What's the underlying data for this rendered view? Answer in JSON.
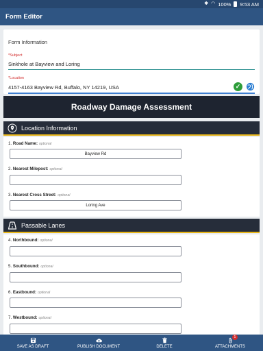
{
  "status_bar": {
    "battery": "100%",
    "time": "9:53 AM"
  },
  "app_bar": {
    "title": "Form Editor"
  },
  "form_information": {
    "title": "Form Information",
    "subject": {
      "label": "*Subject",
      "value": "Sinkhole at Bayview and Loring"
    },
    "location": {
      "label": "*Location",
      "value": "4157-4163 Bayview Rd, Buffalo, NY 14219, USA"
    }
  },
  "form_header": {
    "title": "Roadway Damage Assessment"
  },
  "sections": {
    "location_information": {
      "title": "Location Information",
      "questions": [
        {
          "number": "1.",
          "label": "Road Name:",
          "optional": "optional",
          "value": "Bayview Rd"
        },
        {
          "number": "2.",
          "label": "Nearest Milepost:",
          "optional": "optional",
          "value": ""
        },
        {
          "number": "3.",
          "label": "Nearest Cross Street:",
          "optional": "optional",
          "value": "Loring Ave"
        }
      ]
    },
    "passable_lanes": {
      "title": "Passable Lanes",
      "questions": [
        {
          "number": "4.",
          "label": "Northbound:",
          "optional": "optional",
          "value": ""
        },
        {
          "number": "5.",
          "label": "Southbound:",
          "optional": "optional",
          "value": ""
        },
        {
          "number": "6.",
          "label": "Eastbound:",
          "optional": "optional",
          "value": ""
        },
        {
          "number": "7.",
          "label": "Westbound:",
          "optional": "optional",
          "value": ""
        }
      ]
    }
  },
  "bottom_bar": {
    "save_draft": "SAVE AS DRAFT",
    "publish": "PUBLISH DOCUMENT",
    "delete": "DELETE",
    "attachments": "ATTACHMENTS",
    "attachments_count": "1"
  },
  "colors": {
    "app_bar": "#2f5583",
    "section_bar": "#262d3a",
    "section_accent": "#e8b619",
    "check": "#2e9d3a"
  },
  "icons": [
    "bluetooth-icon",
    "wifi-icon",
    "battery-icon",
    "check-icon",
    "globe-icon",
    "location-pin-icon",
    "road-icon",
    "save-icon",
    "cloud-upload-icon",
    "trash-icon",
    "paperclip-icon"
  ]
}
